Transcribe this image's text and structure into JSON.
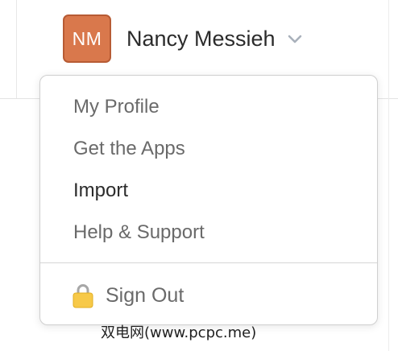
{
  "user": {
    "initials": "NM",
    "name": "Nancy Messieh",
    "avatar_color": "#d9784c"
  },
  "menu": {
    "items": [
      {
        "label": "My Profile",
        "active": false
      },
      {
        "label": "Get the Apps",
        "active": false
      },
      {
        "label": "Import",
        "active": true
      },
      {
        "label": "Help & Support",
        "active": false
      }
    ],
    "sign_out_label": "Sign Out",
    "sign_out_icon": "lock-icon"
  },
  "watermark": "双电网(www.pcpc.me)"
}
